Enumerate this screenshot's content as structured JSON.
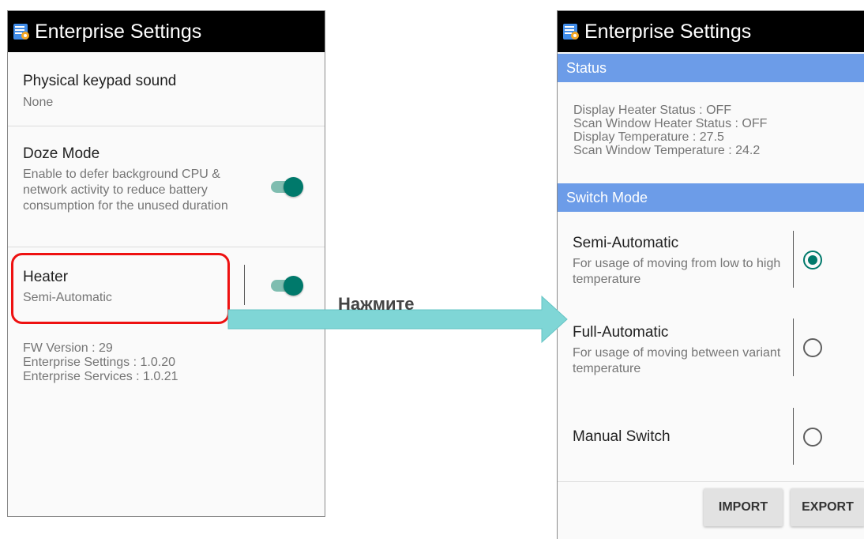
{
  "app": {
    "title": "Enterprise Settings",
    "icon": "enterprise-settings-app-icon"
  },
  "colors": {
    "accent": "#00796b",
    "section_header": "#6c9ce8",
    "highlight": "#ee1111",
    "callout_arrow": "#7fd6d6"
  },
  "left_screen": {
    "keypad_sound": {
      "title": "Physical keypad sound",
      "summary": "None"
    },
    "doze": {
      "title": "Doze Mode",
      "summary": "Enable to defer background CPU & network activity to reduce battery consumption for the unused duration",
      "enabled": true
    },
    "heater": {
      "title": "Heater",
      "summary": "Semi-Automatic",
      "enabled": true
    },
    "info": {
      "fw": "FW Version : 29",
      "settings": "Enterprise Settings : 1.0.20",
      "services": "Enterprise Services : 1.0.21"
    }
  },
  "callout": {
    "text": "Нажмите"
  },
  "right_screen": {
    "status": {
      "header": "Status",
      "lines": [
        "Display Heater Status : OFF",
        "Scan Window Heater Status : OFF",
        "Display Temperature : 27.5",
        "Scan Window Temperature : 24.2"
      ]
    },
    "switch_mode": {
      "header": "Switch Mode",
      "selected": "Semi-Automatic",
      "options": [
        {
          "title": "Semi-Automatic",
          "summary": "For usage of moving from low to high temperature"
        },
        {
          "title": "Full-Automatic",
          "summary": "For usage of moving between variant temperature"
        },
        {
          "title": "Manual Switch",
          "summary": ""
        }
      ]
    },
    "buttons": {
      "import": "IMPORT",
      "export": "EXPORT"
    }
  }
}
